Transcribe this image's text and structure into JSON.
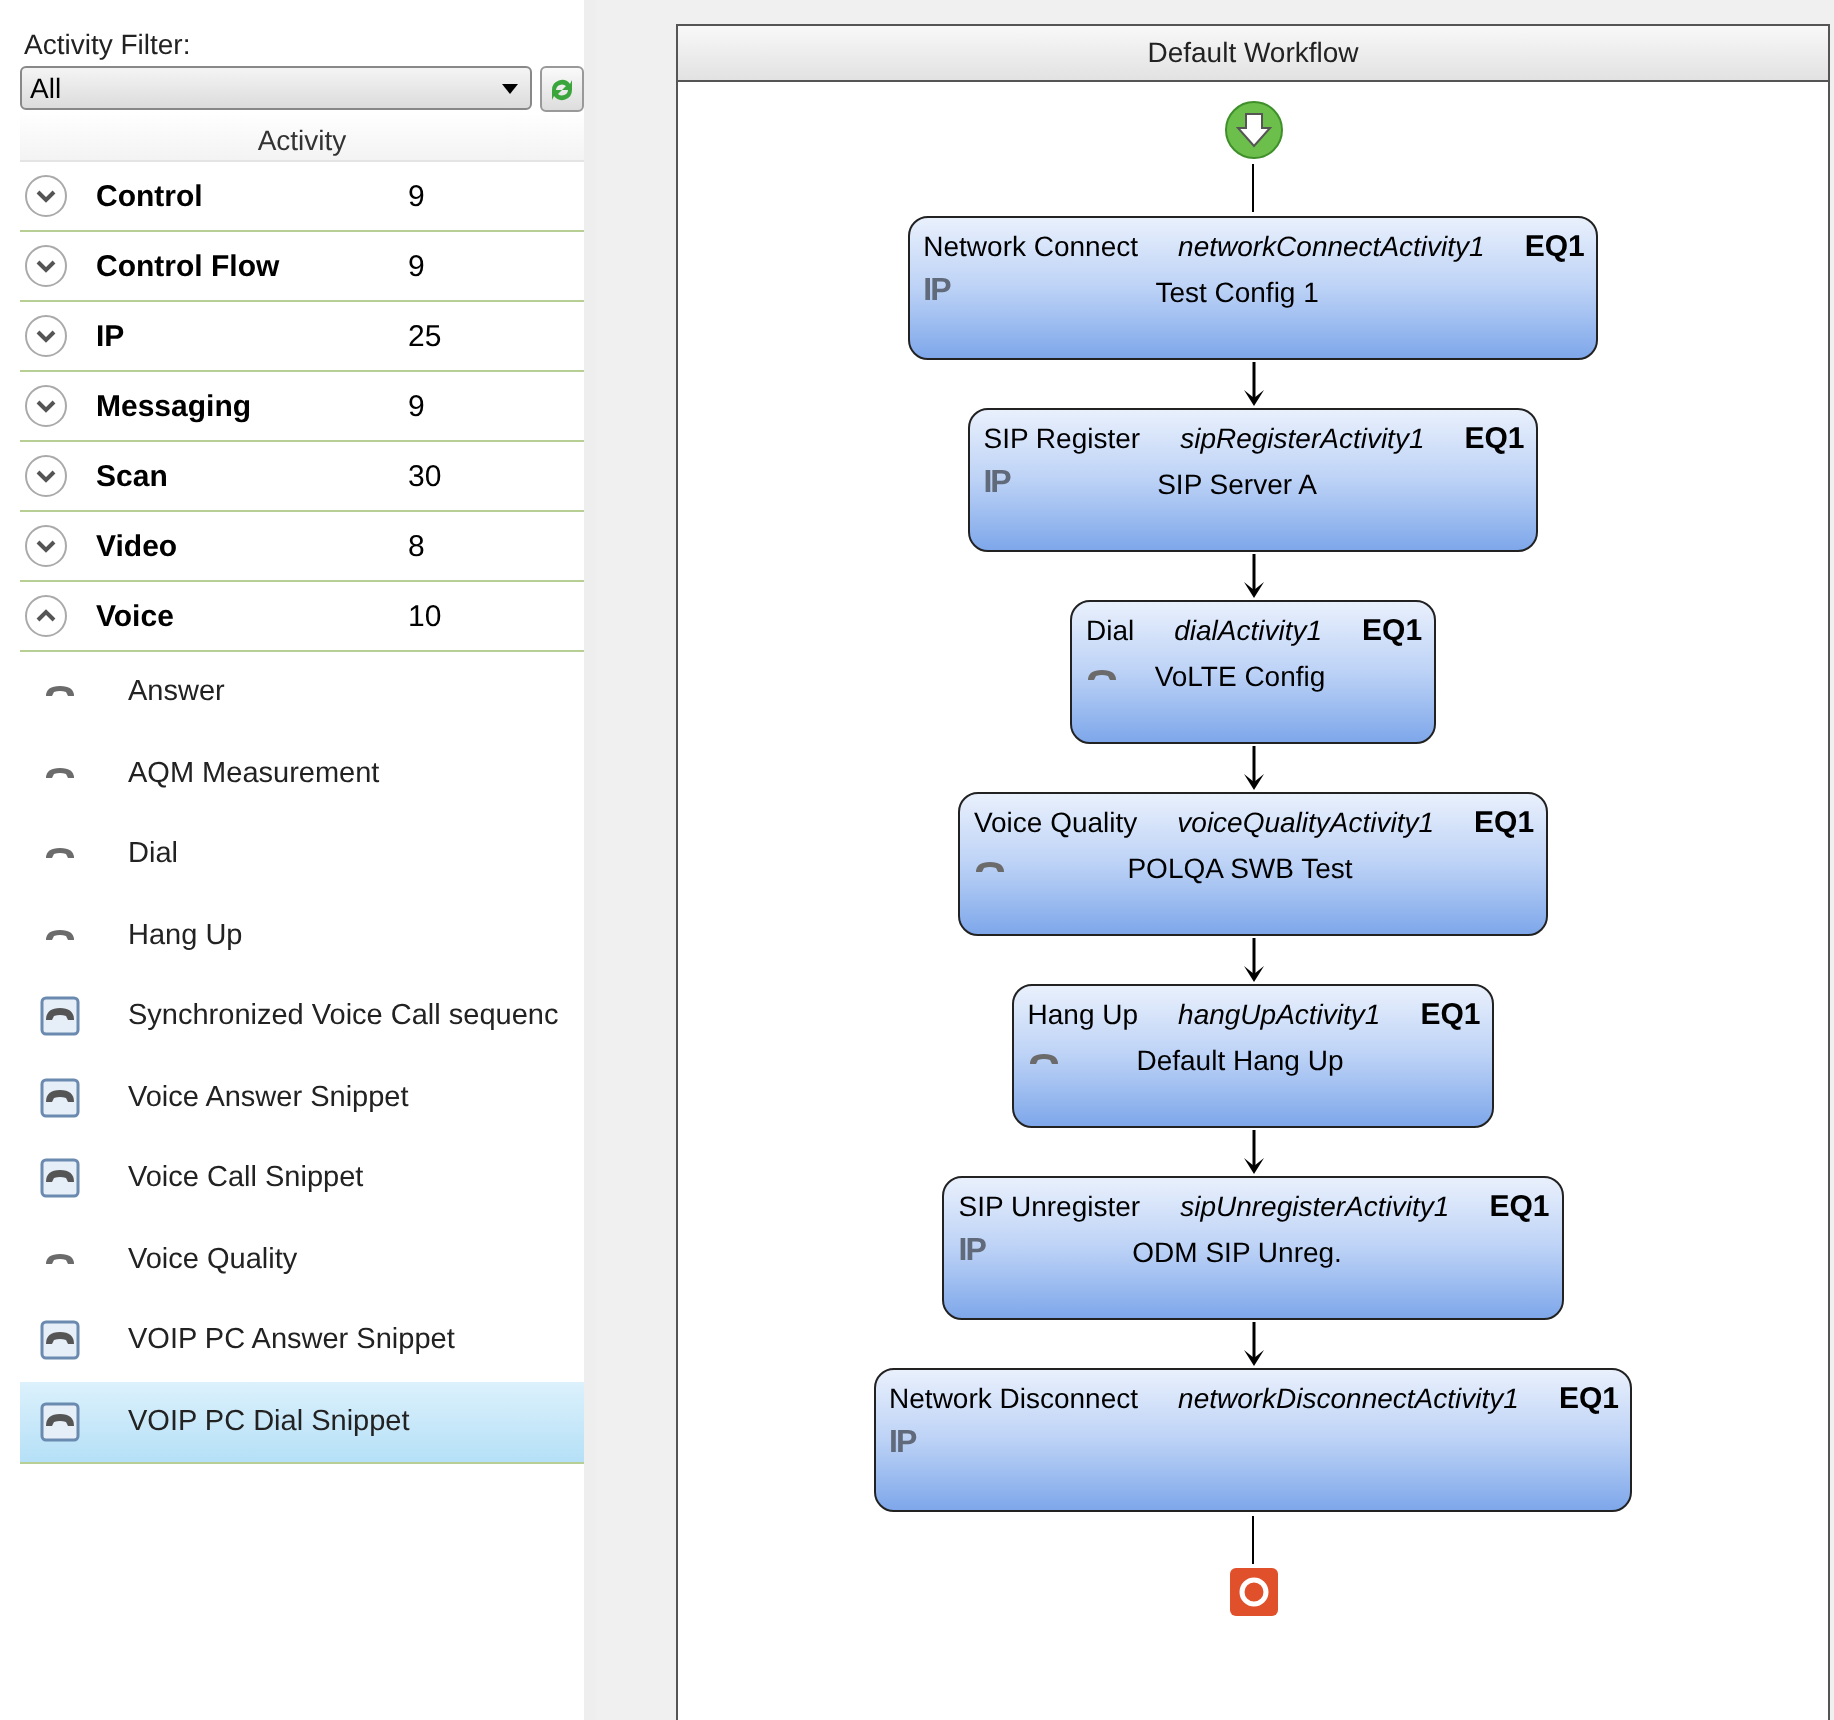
{
  "filter": {
    "label": "Activity Filter:",
    "value": "All"
  },
  "list_header": "Activity",
  "categories": [
    {
      "name": "Control",
      "count": "9",
      "expanded": false
    },
    {
      "name": "Control Flow",
      "count": "9",
      "expanded": false
    },
    {
      "name": "IP",
      "count": "25",
      "expanded": false
    },
    {
      "name": "Messaging",
      "count": "9",
      "expanded": false
    },
    {
      "name": "Scan",
      "count": "30",
      "expanded": false
    },
    {
      "name": "Video",
      "count": "8",
      "expanded": false
    },
    {
      "name": "Voice",
      "count": "10",
      "expanded": true,
      "items": [
        {
          "label": "Answer",
          "kind": "activity",
          "selected": false
        },
        {
          "label": "AQM Measurement",
          "kind": "activity",
          "selected": false
        },
        {
          "label": "Dial",
          "kind": "activity",
          "selected": false
        },
        {
          "label": "Hang Up",
          "kind": "activity",
          "selected": false
        },
        {
          "label": "Synchronized Voice Call sequenc",
          "kind": "snippet",
          "selected": false
        },
        {
          "label": "Voice Answer Snippet",
          "kind": "snippet",
          "selected": false
        },
        {
          "label": "Voice Call Snippet",
          "kind": "snippet",
          "selected": false
        },
        {
          "label": "Voice Quality",
          "kind": "activity",
          "selected": false
        },
        {
          "label": "VOIP PC Answer Snippet",
          "kind": "snippet",
          "selected": false
        },
        {
          "label": "VOIP PC Dial Snippet",
          "kind": "snippet",
          "selected": true
        }
      ]
    }
  ],
  "workflow": {
    "title": "Default Workflow",
    "nodes": [
      {
        "name": "Network Connect",
        "id": "networkConnectActivity1",
        "equipment": "EQ1",
        "kind": "ip",
        "badge": "IP",
        "config": "Test Config 1"
      },
      {
        "name": "SIP Register",
        "id": "sipRegisterActivity1",
        "equipment": "EQ1",
        "kind": "ip",
        "badge": "IP",
        "config": "SIP Server A"
      },
      {
        "name": "Dial",
        "id": "dialActivity1",
        "equipment": "EQ1",
        "kind": "voice",
        "config": "VoLTE Config"
      },
      {
        "name": "Voice Quality",
        "id": "voiceQualityActivity1",
        "equipment": "EQ1",
        "kind": "voice",
        "config": "POLQA SWB Test"
      },
      {
        "name": "Hang Up",
        "id": "hangUpActivity1",
        "equipment": "EQ1",
        "kind": "voice",
        "config": "Default Hang Up"
      },
      {
        "name": "SIP Unregister",
        "id": "sipUnregisterActivity1",
        "equipment": "EQ1",
        "kind": "ip",
        "badge": "IP",
        "config": "ODM SIP Unreg."
      },
      {
        "name": "Network Disconnect",
        "id": "networkDisconnectActivity1",
        "equipment": "EQ1",
        "kind": "ip",
        "badge": "IP"
      }
    ]
  }
}
